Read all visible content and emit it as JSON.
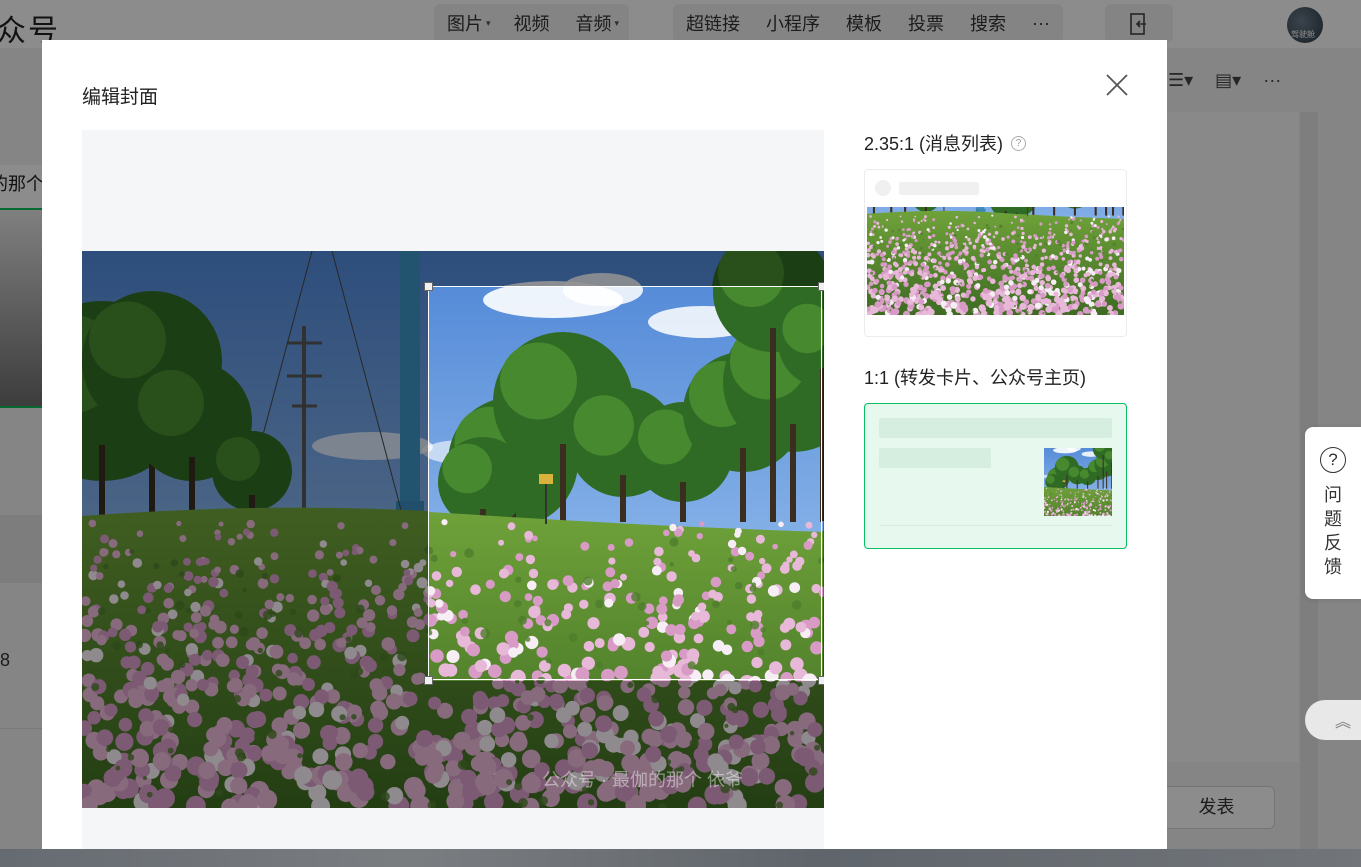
{
  "background": {
    "brand_text": "众号",
    "menu_group_1": [
      {
        "label": "图片",
        "caret": true
      },
      {
        "label": "视频",
        "caret": false
      },
      {
        "label": "音频",
        "caret": true
      }
    ],
    "menu_group_2": [
      {
        "label": "超链接"
      },
      {
        "label": "小程序"
      },
      {
        "label": "模板"
      },
      {
        "label": "投票"
      },
      {
        "label": "搜索"
      },
      {
        "label": "···"
      }
    ],
    "side_tab_text": "的那个",
    "side_number": "8",
    "avatar_text": "驾驶舱",
    "publish_label": "发表",
    "more_label": "···"
  },
  "modal": {
    "title": "编辑封面",
    "watermark": "公众号 · 最伽的那个 依爷",
    "preview_wide_label": "2.35:1 (消息列表)",
    "preview_square_label": "1:1 (转发卡片、公众号主页)"
  },
  "feedback": {
    "label": "问题反馈",
    "icon_text": "?"
  },
  "colors": {
    "accent": "#07c160",
    "accent_light": "#e7f8ee"
  },
  "icons": {
    "close": "close-icon",
    "help": "help-circle-icon",
    "exit": "exit-icon",
    "to_top": "double-chevron-up-icon"
  }
}
